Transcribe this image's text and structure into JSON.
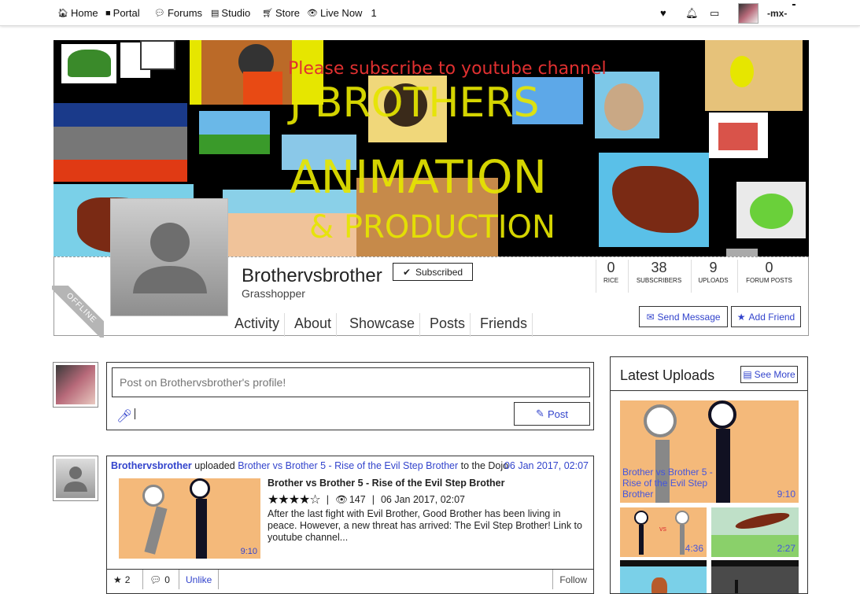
{
  "nav": {
    "home": "Home",
    "portal": "Portal",
    "forums": "Forums",
    "studio": "Studio",
    "store": "Store",
    "live_now": "Live Now",
    "live_count": "1"
  },
  "user": {
    "name": "-mx-"
  },
  "banner": {
    "subscribe_text": "Please subscribe to youtube channel",
    "line1": "J BROTHERS",
    "line2": "ANIMATION",
    "line3": "& PRODUCTION"
  },
  "profile": {
    "name": "Brothervsbrother",
    "rank": "Grasshopper",
    "status": "OFFLINE",
    "subscribe_label": "Subscribed",
    "tabs": [
      "Activity",
      "About",
      "Showcase",
      "Posts",
      "Friends"
    ],
    "stats": [
      {
        "value": "0",
        "label": "RICE"
      },
      {
        "value": "38",
        "label": "SUBSCRIBERS"
      },
      {
        "value": "9",
        "label": "UPLOADS"
      },
      {
        "value": "0",
        "label": "FORUM POSTS"
      }
    ],
    "send_message": "Send Message",
    "add_friend": "Add Friend"
  },
  "post": {
    "placeholder": "Post on Brothervsbrother's profile!",
    "button": "Post"
  },
  "feed": {
    "user": "Brothervsbrother",
    "action": " uploaded ",
    "item": "Brother vs Brother 5 - Rise of the Evil Step Brother",
    "suffix": " to the Dojo",
    "date": "06 Jan 2017, 02:07",
    "title": "Brother vs Brother 5 - Rise of the Evil Step Brother",
    "rating": 4,
    "views": "147",
    "upload_date": "06 Jan 2017, 02:07",
    "description": "After the last fight with Evil Brother, Good Brother has been living in peace. However, a new threat has arrived: The Evil Step Brother! Link to youtube channel...",
    "duration": "9:10",
    "likes": "2",
    "comments": "0",
    "unlike": "Unlike",
    "follow": "Follow"
  },
  "uploads": {
    "title": "Latest Uploads",
    "see_more": "See More",
    "items": [
      {
        "caption": "Brother vs Brother 5 - Rise of the Evil Step Brother",
        "duration": "9:10"
      },
      {
        "caption": "",
        "duration": "4:36"
      },
      {
        "caption": "",
        "duration": "2:27"
      }
    ]
  }
}
